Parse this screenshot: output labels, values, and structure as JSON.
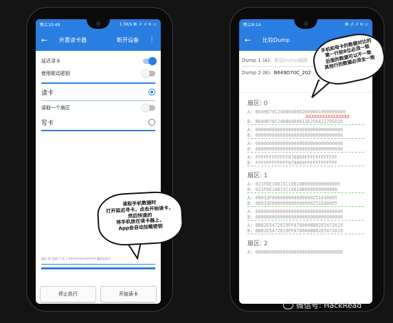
{
  "left": {
    "status_time": "晚上10:49",
    "status_right": "1.5K/s ⊠ .ıl .ıl ≋ ▭",
    "appbar_title": "外置读卡器",
    "appbar_action": "断开设备",
    "menu_icon": "⋮",
    "settings": [
      {
        "label": "延迟寻卡",
        "state": "on"
      },
      {
        "label": "使用联动密钥",
        "state": "off"
      }
    ],
    "read_title": "读卡",
    "read_sector": "读取一个扇区",
    "write_title": "写卡",
    "log_text": "扇区:40  密钥:  1  共  1  ############  最好状态:0",
    "stop_button": "停止执行",
    "start_button": "开始读卡"
  },
  "left_bubble": {
    "lines": [
      "读取手机数据时",
      "打开延迟寻卡，点击开始读卡，",
      "然后快速的",
      "将手机放在读卡器上，",
      "App会自动加载密钥"
    ]
  },
  "right": {
    "status_time": "晚上8:14",
    "status_right": "⊠ .ıl .ıl ≋ ▭",
    "appbar_title": "比较Dump",
    "dump1_label": "Dump 1 (A):",
    "dump1_value": "来自Dump编辑",
    "dump2_label": "Dump 2 (B):",
    "dump2_value": "B649D70C_202",
    "sectors": [
      {
        "title": "扇区: 0",
        "blocks": [
          {
            "a": "B649D70C24080400D2000001000000000",
            "b": "B649D70C24080400013E25A4227EEA1D",
            "diff": "XXXXXXXXXXXXXXXX"
          },
          {
            "a": "00000000000000000000000000000000",
            "b": "00000000000000000000000000000000"
          },
          {
            "a": "00000000000000000000000000000000",
            "b": "00000000000000000000000000000000"
          },
          {
            "a": "FFFFFFFFFFFF078069FFFFFFFFFFFF",
            "b": "FFFFFFFFFFFF078069FFFFFFFFFFFF"
          }
        ]
      },
      {
        "title": "扇区: 1",
        "blocks": [
          {
            "a": "021FDE10015C10010B0000000000800",
            "b": "021FDE10015C10010B000000000800"
          },
          {
            "a": "00033F000000000000000251E40005",
            "b": "00033F000000000000000251E40005"
          },
          {
            "a": "00000000000000000000000000000000",
            "b": "00000000000000000000000000000000"
          },
          {
            "a": "BB82E5472619FF078000BB82E5472619",
            "b": "BB82E5472619FF078000BB82E5472619"
          }
        ]
      },
      {
        "title": "扇区: 2",
        "blocks": [
          {
            "a": "00000000000000000000000000000000",
            "b": ""
          }
        ]
      }
    ]
  },
  "right_bubble": {
    "lines": [
      "手机和母卡的数据对比的",
      "第一行前8位必须一致",
      "后面的数据可以不一致",
      "其他行的数据必须全一致"
    ]
  },
  "watermark": "微信号: HackRead"
}
